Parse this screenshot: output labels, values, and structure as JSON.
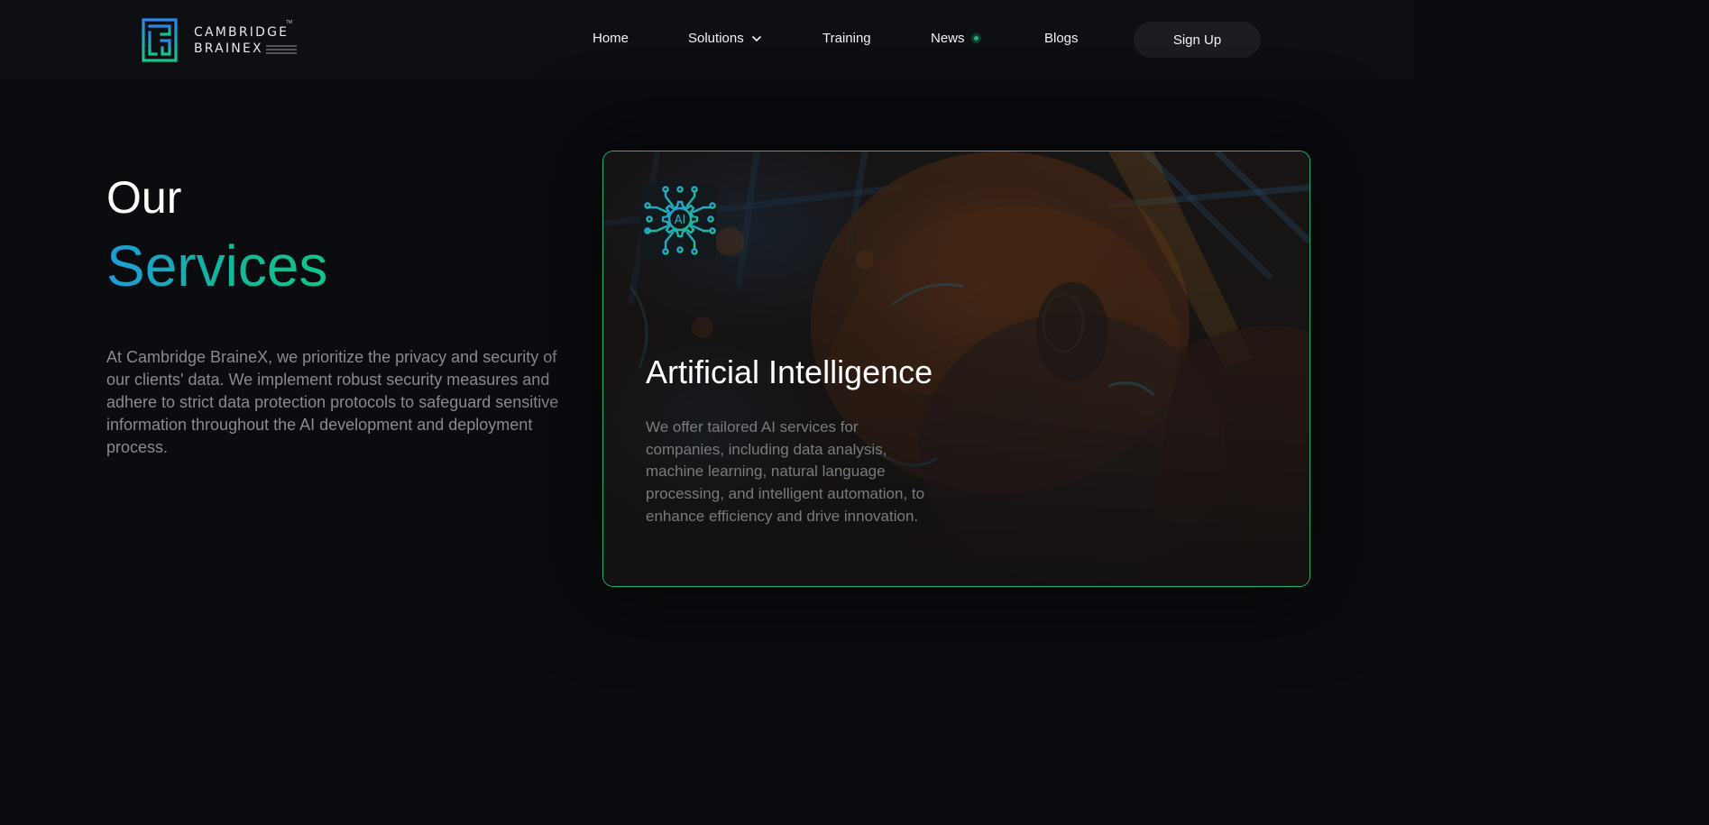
{
  "header": {
    "logo": {
      "line1": "CAMBRIDGE",
      "line2": "BRAINEX",
      "tm": "TM",
      "icon": "brainex-maze-logo"
    },
    "nav": {
      "home": "Home",
      "solutions": "Solutions",
      "training": "Training",
      "news": "News",
      "blogs": "Blogs"
    },
    "signup_label": "Sign Up"
  },
  "intro": {
    "title_line1": "Our",
    "title_line2": "Services",
    "description": "At Cambridge BraineX, we prioritize the privacy and security of our clients' data. We implement robust security measures and adhere to strict data protection protocols to safeguard sensitive information throughout the AI development and deployment process."
  },
  "card": {
    "icon": "ai-circuit-gear-icon",
    "icon_text": "AI",
    "title": "Artificial Intelligence",
    "description": "We offer tailored AI services for companies, including data analysis, machine learning, natural language processing, and intelligent automation, to enhance efficiency and drive innovation."
  },
  "colors": {
    "background": "#0b0c10",
    "header": "#0e0f13",
    "accent_blue": "#1f9bd8",
    "accent_green": "#12c48a",
    "card_border": "#1fb57a",
    "muted_text": "#8a8b8f"
  }
}
